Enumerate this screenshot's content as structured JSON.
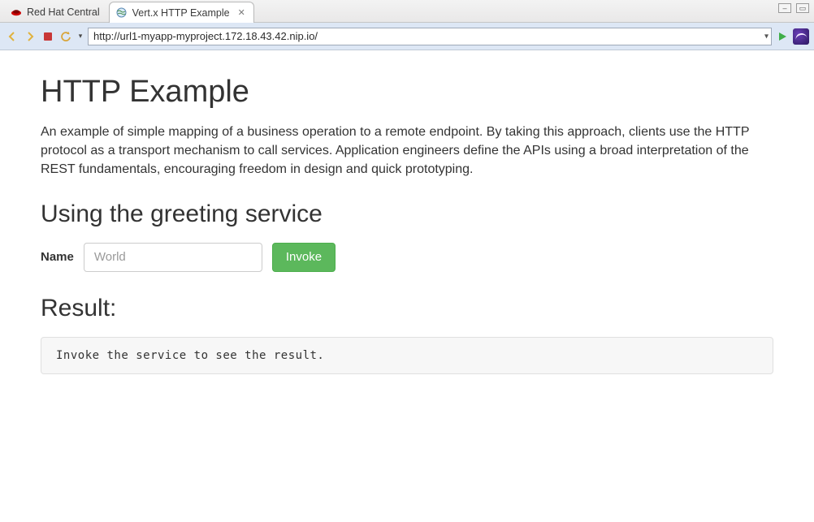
{
  "tabs": {
    "inactive": {
      "label": "Red Hat Central"
    },
    "active": {
      "label": "Vert.x HTTP Example"
    }
  },
  "toolbar": {
    "url": "http://url1-myapp-myproject.172.18.43.42.nip.io/"
  },
  "page": {
    "title": "HTTP Example",
    "lead": "An example of simple mapping of a business operation to a remote endpoint. By taking this approach, clients use the HTTP protocol as a transport mechanism to call services. Application engineers define the APIs using a broad interpretation of the REST fundamentals, encouraging freedom in design and quick prototyping.",
    "section_heading": "Using the greeting service",
    "form": {
      "name_label": "Name",
      "name_placeholder": "World",
      "invoke_label": "Invoke"
    },
    "result_heading": "Result:",
    "result_text": "Invoke the service to see the result."
  },
  "colors": {
    "button_green": "#5cb85c",
    "toolbar_blue": "#dde7f5"
  }
}
